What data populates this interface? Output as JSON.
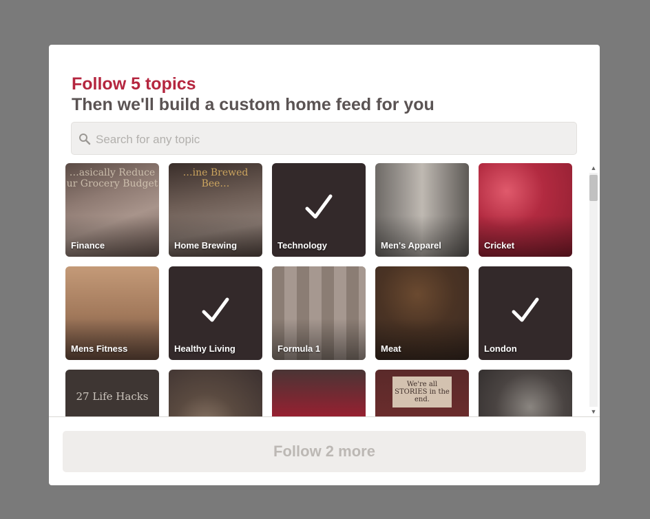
{
  "dialog": {
    "heading": "Follow 5 topics",
    "subheading": "Then we'll build a custom home feed for you"
  },
  "search": {
    "placeholder": "Search for any topic",
    "value": "",
    "icon": "search-icon"
  },
  "topics": [
    {
      "label": "Finance",
      "selected": false,
      "image_text": "…asically Reduce ur Grocery Budget"
    },
    {
      "label": "Home Brewing",
      "selected": false,
      "image_text": "…ine Brewed Bee…"
    },
    {
      "label": "Technology",
      "selected": true
    },
    {
      "label": "Men's Apparel",
      "selected": false
    },
    {
      "label": "Cricket",
      "selected": false
    },
    {
      "label": "Mens Fitness",
      "selected": false
    },
    {
      "label": "Healthy Living",
      "selected": true
    },
    {
      "label": "Formula 1",
      "selected": false
    },
    {
      "label": "Meat",
      "selected": false
    },
    {
      "label": "London",
      "selected": true
    },
    {
      "label": "",
      "selected": false,
      "image_text": "27 Life Hacks"
    },
    {
      "label": "",
      "selected": false
    },
    {
      "label": "",
      "selected": false
    },
    {
      "label": "",
      "selected": false,
      "image_text": "We're all STORIES in the end."
    },
    {
      "label": "",
      "selected": false
    }
  ],
  "footer": {
    "follow_button": "Follow 2 more"
  },
  "colors": {
    "accent": "#b5263f",
    "selected_tile": "#33292a",
    "overlay": "#7a7a7a"
  }
}
